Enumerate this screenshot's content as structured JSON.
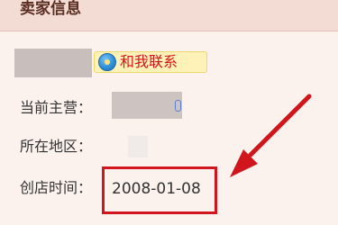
{
  "panel": {
    "title": "卖家信息"
  },
  "seller": {
    "contact_label": "和我联系",
    "contact_icon": "chat-bubble-icon"
  },
  "fields": {
    "manager_label": "当前主营：",
    "location_label": "所在地区：",
    "opened_label": "创店时间：",
    "opened_value": "2008-01-08"
  },
  "annotation": {
    "color": "#d0161c"
  }
}
